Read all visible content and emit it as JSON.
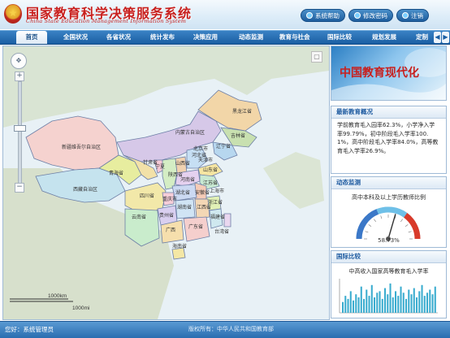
{
  "header": {
    "title": "国家教育科学决策服务系统",
    "subtitle": "China State Education Management Information System",
    "buttons": [
      {
        "label": "系统帮助",
        "icon": "help-icon"
      },
      {
        "label": "修改密码",
        "icon": "lock-icon"
      },
      {
        "label": "注销",
        "icon": "logout-icon"
      }
    ]
  },
  "nav": {
    "items": [
      "首页",
      "全国状况",
      "各省状况",
      "统计发布",
      "决策应用",
      "动态监测",
      "教育与社会",
      "国际比较",
      "规划发展",
      "定制"
    ],
    "active_index": 0
  },
  "map": {
    "provinces": {
      "heilongjiang": "黑龙江省",
      "jilin": "吉林省",
      "liaoning": "辽宁省",
      "neimenggu": "内蒙古自治区",
      "xinjiang": "新疆维吾尔自治区",
      "xizang": "西藏自治区",
      "qinghai": "青海省",
      "gansu": "甘肃省",
      "ningxia": "宁夏",
      "shaanxi": "陕西省",
      "shanxi": "山西省",
      "hebei": "河北省",
      "beijing": "北京市",
      "tianjin": "天津市",
      "shandong": "山东省",
      "henan": "河南省",
      "jiangsu": "江苏省",
      "anhui": "安徽省",
      "shanghai": "上海市",
      "hubei": "湖北省",
      "sichuan": "四川省",
      "chongqing": "重庆市",
      "zhejiang": "浙江省",
      "hunan": "湖南省",
      "jiangxi": "江西省",
      "guizhou": "贵州省",
      "yunnan": "云南省",
      "guangxi": "广西",
      "guangdong": "广东省",
      "fujian": "福建省",
      "taiwan": "台湾省",
      "hainan": "海南省"
    },
    "scale_km": "1000km",
    "scale_mi": "1000mi",
    "colors": {
      "sea": "#e8f1f6",
      "land": "#d4dfd0",
      "border": "#6d7fa6"
    }
  },
  "banner": {
    "title": "中国教育现代化"
  },
  "news": {
    "heading": "最新教育概况",
    "text": "学前教育毛入园率62.3%，小学净入学率99.79%，初中阶段毛入学率100.1%，高中阶段毛入学率84.0%，高等教育毛入学率26.9%。"
  },
  "monitor": {
    "heading": "动态监测",
    "caption": "高中本科及以上学历教师比例",
    "value": "58.73%",
    "gauge_fraction": 0.59
  },
  "intl": {
    "heading": "国际比较",
    "caption": "中高收入国家高等教育毛入学率",
    "bar_color": "#3aaccf",
    "bars": [
      0.35,
      0.55,
      0.45,
      0.7,
      0.4,
      0.6,
      0.5,
      0.85,
      0.45,
      0.75,
      0.55,
      0.9,
      0.5,
      0.65,
      0.7,
      0.45,
      0.8,
      0.6,
      0.95,
      0.5,
      0.7,
      0.55,
      0.85,
      0.65,
      0.45,
      0.75,
      0.6,
      0.8,
      0.5,
      0.7,
      0.9,
      0.55,
      0.65,
      0.75,
      0.6,
      0.85
    ]
  },
  "status": {
    "user": "您好：系统管理员",
    "copyright": "版权所有：中华人民共和国教育部"
  }
}
